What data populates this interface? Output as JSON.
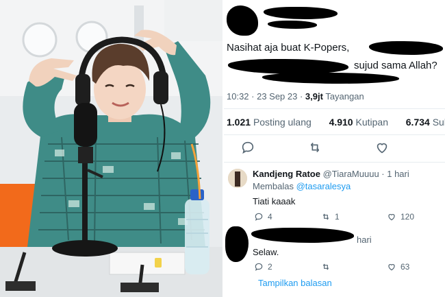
{
  "tweet": {
    "text_line1": "Nasihat aja buat K-Popers,",
    "text_line2_tail": "sujud sama Allah?",
    "time": "10:32 · 23 Sep 23 · ",
    "views_count": "3,9jt",
    "views_label": " Tayangan",
    "reposts_count": "1.021",
    "reposts_label": "Posting ulang",
    "quotes_count": "4.910",
    "quotes_label": "Kutipan",
    "likes_count": "6.734",
    "likes_label": "Suka"
  },
  "replies": [
    {
      "name": "Kandjeng Ratoe",
      "handle": "@TiaraMuuuu · 1 hari",
      "replying_label": "Membalas ",
      "replying_to": "@tasaralesya",
      "text": "Tiati kaaak",
      "reply_count": "4",
      "retweet_count": "1",
      "like_count": "120"
    },
    {
      "name": "",
      "handle": "hari",
      "text": "Selaw.",
      "reply_count": "2",
      "retweet_count": "",
      "like_count": "63"
    }
  ],
  "show_replies_label": "Tampilkan balasan",
  "colors": {
    "accent": "#1d9bf0",
    "muted": "#536471",
    "shirt": "#3f8c87",
    "orange": "#f26a1b"
  },
  "icons": [
    "reply-icon",
    "retweet-icon",
    "like-icon",
    "share-icon"
  ]
}
